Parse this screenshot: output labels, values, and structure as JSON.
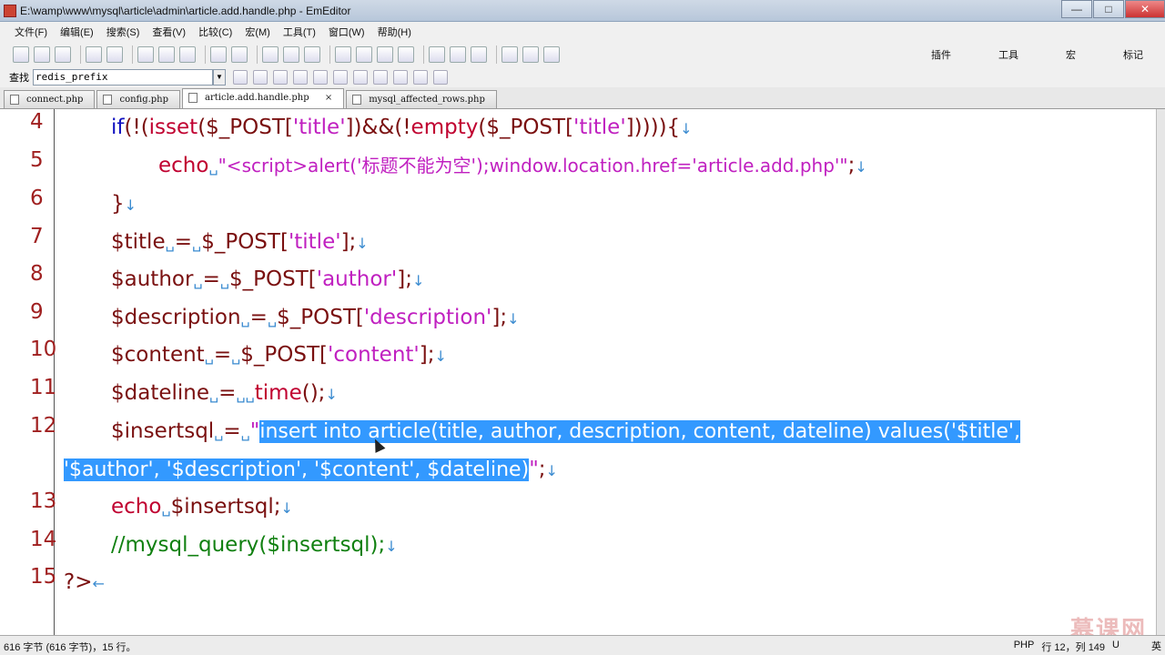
{
  "window": {
    "title": "E:\\wamp\\www\\mysql\\article\\admin\\article.add.handle.php - EmEditor",
    "minimize": "—",
    "maximize": "□",
    "close": "✕"
  },
  "menu": [
    "文件(F)",
    "编辑(E)",
    "搜索(S)",
    "查看(V)",
    "比较(C)",
    "宏(M)",
    "工具(T)",
    "窗口(W)",
    "帮助(H)"
  ],
  "toolbar_right": [
    "插件",
    "工具",
    "宏",
    "标记"
  ],
  "find": {
    "label": "查找",
    "value": "redis_prefix"
  },
  "tabs": [
    {
      "label": "connect.php",
      "active": false
    },
    {
      "label": "config.php",
      "active": false
    },
    {
      "label": "article.add.handle.php",
      "active": true,
      "close": "×"
    },
    {
      "label": "mysql_affected_rows.php",
      "active": false
    }
  ],
  "editor": {
    "line_numbers": [
      "4",
      "5",
      "6",
      "7",
      "8",
      "9",
      "10",
      "11",
      "12",
      "13",
      "14",
      "15"
    ],
    "lines": {
      "l4a": "if",
      "l4b": "(!(",
      "l4c": "isset",
      "l4d": "($_POST[",
      "l4e": "'title'",
      "l4f": "])&&(!",
      "l4g": "empty",
      "l4h": "($_POST[",
      "l4i": "'title'",
      "l4j": "])))){",
      "l5a": "echo",
      "l5b": "\"<script>alert('标题不能为空');window.location.href='article.add.php'\"",
      "l5c": ";",
      "l6a": "}",
      "l7a": "$title",
      "l7b": "=",
      "l7c": "$_POST[",
      "l7d": "'title'",
      "l7e": "];",
      "l8a": "$author",
      "l8b": "=",
      "l8c": "$_POST[",
      "l8d": "'author'",
      "l8e": "];",
      "l9a": "$description",
      "l9b": "=",
      "l9c": "$_POST[",
      "l9d": "'description'",
      "l9e": "];",
      "l10a": "$content",
      "l10b": "=",
      "l10c": "$_POST[",
      "l10d": "'content'",
      "l10e": "];",
      "l11a": "$dateline",
      "l11b": "=",
      "l11c": "time",
      "l11d": "();",
      "l12a": "$insertsql",
      "l12b": "=",
      "l12c": "\"",
      "l12d": "insert into article(title, author, description, content, dateline) values('$title',",
      "l12e": "'$author', '$description', '$content', $dateline)",
      "l12f": "\"",
      "l12g": ";",
      "l13a": "echo",
      "l13b": "$insertsql",
      "l13c": ";",
      "l14a": "//mysql_query($insertsql);",
      "l15a": "?>"
    },
    "space_mark": "␣",
    "eol_mark": "↓",
    "eof_mark": "←"
  },
  "status": {
    "left": "616 字节 (616 字节)，15 行。",
    "lang": "PHP",
    "pos": "行 12，列 149",
    "enc": "U",
    "ime": "英"
  },
  "watermark": "慕课网"
}
